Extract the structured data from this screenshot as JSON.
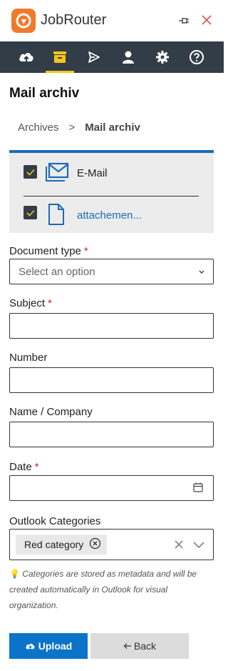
{
  "header": {
    "app_title": "JobRouter",
    "pin_icon": "pin-icon",
    "close_icon": "close-icon"
  },
  "toolbar": {
    "items": [
      {
        "icon": "upload-cloud-icon",
        "active": false
      },
      {
        "icon": "archive-icon",
        "active": true
      },
      {
        "icon": "send-icon",
        "active": false
      },
      {
        "icon": "user-icon",
        "active": false
      },
      {
        "icon": "gear-icon",
        "active": false
      },
      {
        "icon": "help-icon",
        "active": false
      }
    ],
    "active_color": "#f5c518",
    "background": "#333d47"
  },
  "page": {
    "title": "Mail archiv"
  },
  "breadcrumb": {
    "parent": "Archives",
    "separator": ">",
    "current": "Mail archiv"
  },
  "attachments": [
    {
      "label": "E-Mail",
      "checked": true,
      "icon": "mail-icon"
    },
    {
      "label": "attachemen...",
      "checked": true,
      "icon": "document-icon"
    }
  ],
  "form": {
    "document_type": {
      "label": "Document type",
      "required": "*",
      "placeholder": "Select an option"
    },
    "subject": {
      "label": "Subject",
      "required": "*",
      "value": ""
    },
    "number": {
      "label": "Number",
      "value": ""
    },
    "name_company": {
      "label": "Name / Company",
      "value": ""
    },
    "date": {
      "label": "Date",
      "required": "*",
      "value": ""
    },
    "outlook_categories": {
      "label": "Outlook Categories",
      "selected": [
        "Red category"
      ]
    },
    "hint": "Categories are stored as metadata and will be created automatically in Outlook for visual organization."
  },
  "actions": {
    "upload_label": "Upload",
    "back_label": "Back"
  },
  "colors": {
    "accent_blue": "#0b74c8",
    "required_red": "#c62828",
    "logo_orange": "#f07a2c"
  }
}
